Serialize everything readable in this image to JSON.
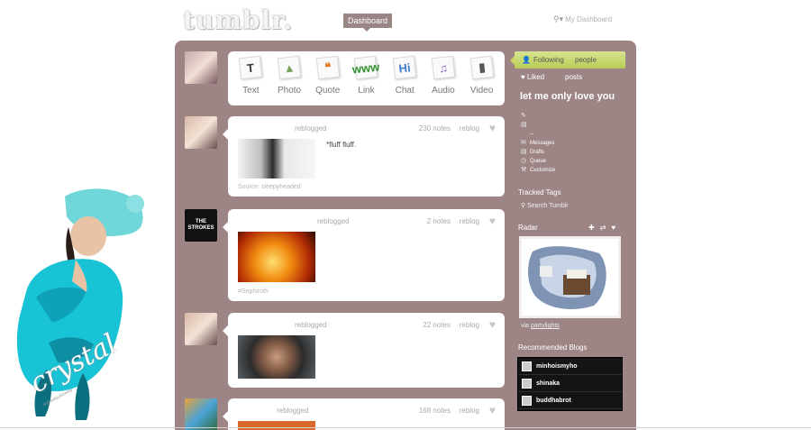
{
  "header": {
    "logo": "tumblr.",
    "nav_dashboard": "Dashboard",
    "search_link": "My Dashboard"
  },
  "post_types": [
    {
      "label": "Text",
      "icon": "text-icon",
      "glyph": "T",
      "color": "#333333"
    },
    {
      "label": "Photo",
      "icon": "photo-icon",
      "glyph": "▲",
      "color": "#7aa25a"
    },
    {
      "label": "Quote",
      "icon": "quote-icon",
      "glyph": "❝",
      "color": "#e07b1c"
    },
    {
      "label": "Link",
      "icon": "link-icon",
      "glyph": "www",
      "color": "#2f8f2f"
    },
    {
      "label": "Chat",
      "icon": "chat-icon",
      "glyph": "Hi",
      "color": "#3d7bd1"
    },
    {
      "label": "Audio",
      "icon": "audio-icon",
      "glyph": "♫",
      "color": "#8a5cc7"
    },
    {
      "label": "Video",
      "icon": "video-icon",
      "glyph": "▮",
      "color": "#555555"
    }
  ],
  "posts": [
    {
      "action": "reblogged",
      "notes": "230 notes",
      "reblog": "reblog",
      "caption": "*fluff fluff.",
      "source": "Source: sleepyheaded"
    },
    {
      "action": "reblogged",
      "notes": "2 notes",
      "reblog": "reblog",
      "source": "#Sephiroth",
      "avatar_text": "THE STROKES"
    },
    {
      "action": "reblogged",
      "notes": "22 notes",
      "reblog": "reblog"
    },
    {
      "action": "reblogged",
      "notes": "168 notes",
      "reblog": "reblog"
    }
  ],
  "sidebar": {
    "following": "Following",
    "following_count": "people",
    "liked": "Liked",
    "liked_count": "posts",
    "blog_title": "let me only love you",
    "links": [
      {
        "icon": "edit-icon",
        "label": ""
      },
      {
        "icon": "document-icon",
        "label": ""
      },
      {
        "icon": "dash-icon",
        "label": "--"
      },
      {
        "icon": "mail-icon",
        "label": "Messages"
      },
      {
        "icon": "draft-icon",
        "label": "Drafts"
      },
      {
        "icon": "clock-icon",
        "label": "Queue"
      },
      {
        "icon": "wrench-icon",
        "label": "Customize"
      }
    ],
    "tracked_tags": "Tracked Tags",
    "search_tumblr": "Search Tumblr",
    "radar": "Radar",
    "radar_via": "via",
    "radar_source": "partylights",
    "recommended": "Recommended Blogs",
    "recommended_blogs": [
      "minhoismyho",
      "shinaka",
      "buddhabrot"
    ]
  },
  "graphic": {
    "signature": "crystal",
    "sub_signature": "someday/lovelily"
  },
  "colors": {
    "panel": "#9e8585",
    "following_bar": "#c4d466",
    "nav_active": "#9a8585"
  }
}
